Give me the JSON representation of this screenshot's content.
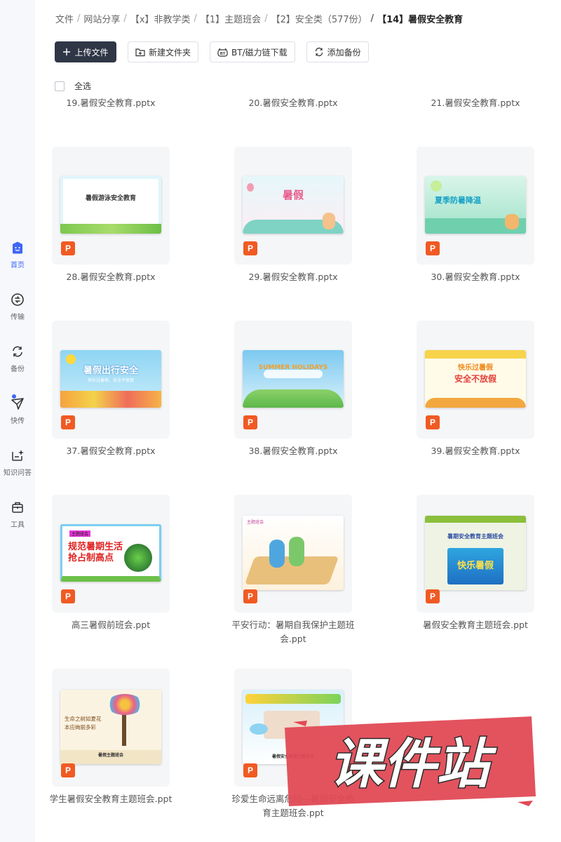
{
  "sidebar": {
    "items": [
      {
        "label": "首页",
        "icon": "home-icon"
      },
      {
        "label": "传输",
        "icon": "transfer-icon"
      },
      {
        "label": "备份",
        "icon": "backup-icon"
      },
      {
        "label": "快传",
        "icon": "send-icon"
      },
      {
        "label": "知识问答",
        "icon": "qa-icon"
      },
      {
        "label": "工具",
        "icon": "toolbox-icon"
      }
    ]
  },
  "breadcrumb": [
    "文件",
    "网站分享",
    "【x】非教学类",
    "【1】主题班会",
    "【2】安全类（577份）",
    "【14】暑假安全教育"
  ],
  "toolbar": {
    "upload": "上传文件",
    "new_folder": "新建文件夹",
    "bt_download": "BT/磁力链下载",
    "add_backup": "添加备份"
  },
  "select_all": "全选",
  "top_row_files": [
    "19.暑假安全教育.pptx",
    "20.暑假安全教育.pptx",
    "21.暑假安全教育.pptx"
  ],
  "files": [
    {
      "name": "28.暑假安全教育.pptx",
      "thumb_text": [
        "暑假游泳安全教育"
      ]
    },
    {
      "name": "29.暑假安全教育.pptx",
      "thumb_text": [
        "暑假"
      ]
    },
    {
      "name": "30.暑假安全教育.pptx",
      "thumb_text": [
        "夏季防暑降温"
      ]
    },
    {
      "name": "37.暑假安全教育.pptx",
      "thumb_text": [
        "暑假出行安全",
        "快乐过暑假，安全不放假"
      ]
    },
    {
      "name": "38.暑假安全教育.pptx",
      "thumb_text": [
        "SUMMER HOLIDAYS"
      ]
    },
    {
      "name": "39.暑假安全教育.pptx",
      "thumb_text": [
        "快乐过暑假",
        "安全不放假"
      ]
    },
    {
      "name": "高三暑假前班会.ppt",
      "thumb_text": [
        "主题班会",
        "规范暑期生活",
        "抢占制高点"
      ]
    },
    {
      "name": "平安行动：暑期自我保护主题班会.ppt",
      "thumb_text": [
        "主题班会"
      ]
    },
    {
      "name": "暑假安全教育主题班会.ppt",
      "thumb_text": [
        "暑期安全教育主题班会",
        "快乐暑假"
      ]
    },
    {
      "name": "学生暑假安全教育主题班会.ppt",
      "thumb_text": [
        "生命之树如夏花",
        "本应绚丽多彩",
        "暑假主题班会"
      ]
    },
    {
      "name": "珍爱生命远离危险—暑假安全教育主题班会.ppt",
      "thumb_text": [
        "暑假安全教育主题班会"
      ]
    }
  ],
  "file_type_badge": "P",
  "watermark": "课件站",
  "colors": {
    "accent": "#3f66f6",
    "ppt": "#f05a23",
    "primary_button": "#2f3747",
    "watermark": "#e04a55"
  }
}
